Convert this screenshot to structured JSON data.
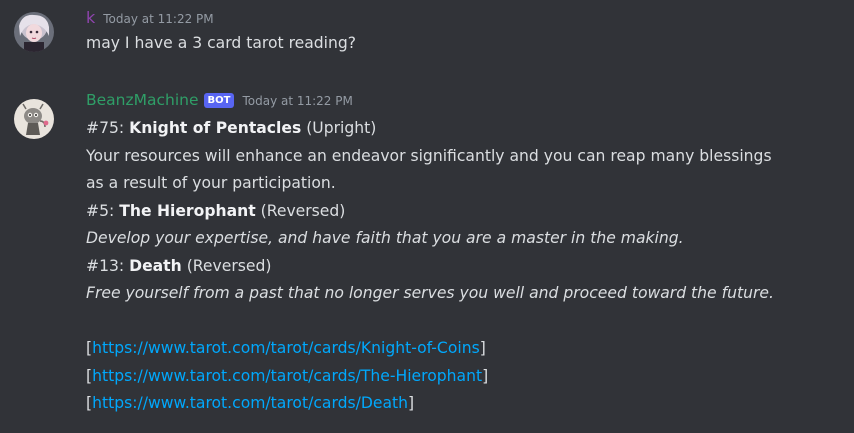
{
  "messages": [
    {
      "author": "k",
      "timestamp": "Today at 11:22 PM",
      "text": "may I have a 3 card tarot reading?"
    },
    {
      "author": "BeanzMachine",
      "bot_tag": "BOT",
      "timestamp": "Today at 11:22 PM",
      "cards": [
        {
          "number": "#75: ",
          "name": "Knight of Pentacles",
          "orientation": " (Upright)",
          "meaning": "Your resources will enhance an endeavor significantly and you can reap many blessings",
          "meaning_cont": "as a result of your participation."
        },
        {
          "number": "#5: ",
          "name": "The Hierophant",
          "orientation": " (Reversed)",
          "meaning": "Develop your expertise, and have faith that you are a master in the making."
        },
        {
          "number": "#13: ",
          "name": "Death",
          "orientation": " (Reversed)",
          "meaning": "Free yourself from a past that no longer serves you well and proceed toward the future."
        }
      ],
      "links": [
        "https://www.tarot.com/tarot/cards/Knight-of-Coins",
        "https://www.tarot.com/tarot/cards/The-Hierophant",
        "https://www.tarot.com/tarot/cards/Death"
      ],
      "bracket_open": "[",
      "bracket_close": "]"
    }
  ],
  "colors": {
    "background": "#313338",
    "user_k": "#8e44ad",
    "user_bot": "#2f9e67",
    "bot_tag": "#5865f2",
    "link": "#00a8fc"
  },
  "icons": {
    "avatar_k": "user-avatar-icon",
    "avatar_bot": "bot-avatar-icon"
  }
}
